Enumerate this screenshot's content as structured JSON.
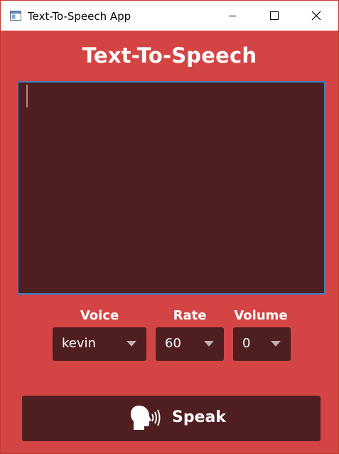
{
  "window": {
    "title": "Text-To-Speech App",
    "controls": {
      "minimize_icon": "minimize-icon",
      "maximize_icon": "maximize-icon",
      "close_icon": "close-icon"
    }
  },
  "app": {
    "heading": "Text-To-Speech",
    "text_input": {
      "value": "",
      "placeholder": ""
    },
    "voice": {
      "label": "Voice",
      "selected": "kevin"
    },
    "rate": {
      "label": "Rate",
      "selected": "60"
    },
    "volume": {
      "label": "Volume",
      "selected": "0"
    },
    "speak_button": {
      "label": "Speak",
      "icon": "speaking-head-icon"
    }
  },
  "colors": {
    "background": "#d44444",
    "panel": "#4e1e20",
    "text": "#ffffff",
    "focus_border": "#3d7fc2"
  }
}
